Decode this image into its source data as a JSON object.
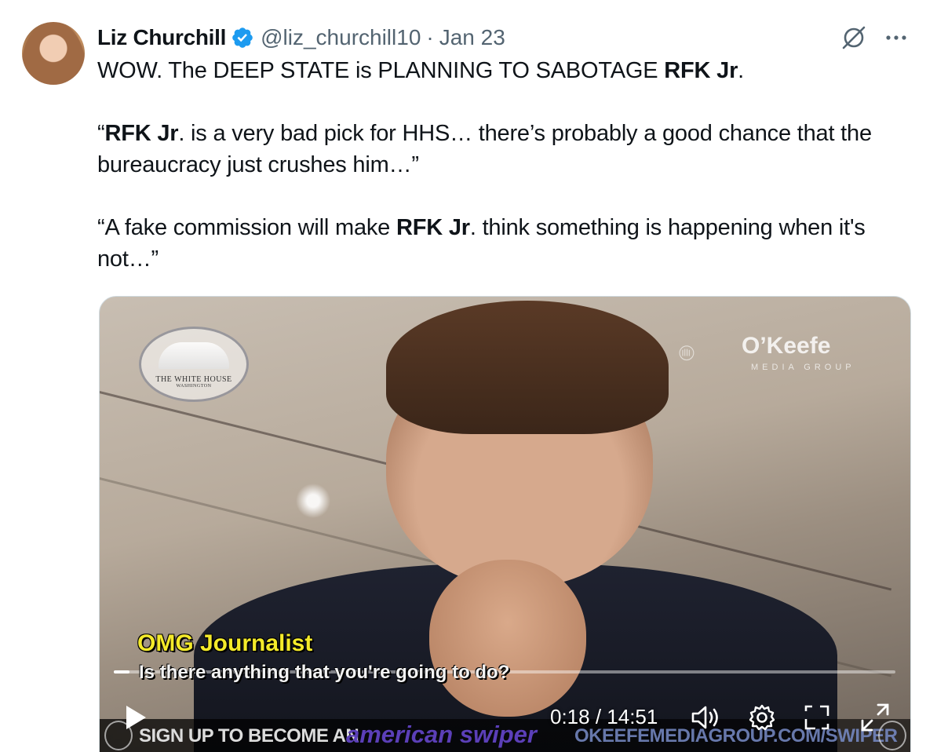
{
  "tweet": {
    "author_name": "Liz Churchill",
    "handle": "@liz_churchill10",
    "separator": "·",
    "date": "Jan 23",
    "body": {
      "line1_pre": "WOW. The DEEP STATE is PLANNING TO SABOTAGE ",
      "line1_bold": "RFK Jr",
      "line1_post": ".",
      "quote1_open": "“",
      "quote1_bold": "RFK Jr",
      "quote1_rest": ". is a very bad pick for HHS… there’s probably a good chance that the bureaucracy just crushes him…”",
      "quote2_pre": "“A fake commission will make ",
      "quote2_bold": "RFK Jr",
      "quote2_post": ". think something is happening when it's not…”"
    }
  },
  "video": {
    "watermark_seal_text": "THE WHITE HOUSE",
    "watermark_seal_sub": "WASHINGTON",
    "okeefe_name": "O’Keefe",
    "okeefe_sub": "MEDIA GROUP",
    "caption_speaker": "OMG Journalist",
    "caption_text": "Is there anything that you're going to do?",
    "banner_left": "SIGN UP TO BECOME AN",
    "banner_brand": "american swiper",
    "banner_url": "OKEEFEMEDIAGROUP.COM/SWIPER",
    "current_time": "0:18",
    "time_sep": " / ",
    "duration": "14:51",
    "progress_fraction": 0.02
  },
  "colors": {
    "verified_badge": "#1d9bf0",
    "secondary_text": "#536471",
    "caption_speaker": "#f4ea2a"
  },
  "icons": {
    "verified": "verified-badge-icon",
    "grok": "grok-icon",
    "more": "more-horizontal-icon",
    "play": "play-icon",
    "volume": "volume-icon",
    "settings": "gear-icon",
    "pip": "picture-in-picture-icon",
    "fullscreen": "fullscreen-icon"
  }
}
